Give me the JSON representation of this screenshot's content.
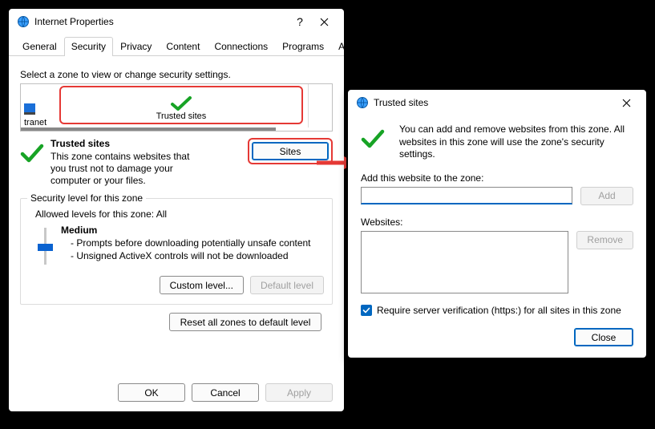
{
  "ip": {
    "title": "Internet Properties",
    "tabs": [
      "General",
      "Security",
      "Privacy",
      "Content",
      "Connections",
      "Programs",
      "Advanced"
    ],
    "active_tab": 1,
    "zone_instruction": "Select a zone to view or change security settings.",
    "zone_left_label": "tranet",
    "zone_center_label": "Trusted sites",
    "zone_title": "Trusted sites",
    "zone_desc": "This zone contains websites that you trust not to damage your computer or your files.",
    "sites_btn": "Sites",
    "group_title": "Security level for this zone",
    "allowed_levels": "Allowed levels for this zone: All",
    "level_name": "Medium",
    "level_line1": "- Prompts before downloading potentially unsafe content",
    "level_line2": "- Unsigned ActiveX controls will not be downloaded",
    "custom_btn": "Custom level...",
    "default_btn": "Default level",
    "reset_btn": "Reset all zones to default level",
    "ok_btn": "OK",
    "cancel_btn": "Cancel",
    "apply_btn": "Apply",
    "help_glyph": "?"
  },
  "ts": {
    "title": "Trusted sites",
    "intro": "You can add and remove websites from this zone. All websites in this zone will use the zone's security settings.",
    "add_label": "Add this website to the zone:",
    "add_btn": "Add",
    "websites_label": "Websites:",
    "remove_btn": "Remove",
    "https_label": "Require server verification (https:) for all sites in this zone",
    "https_checked": true,
    "close_btn": "Close",
    "input_value": ""
  }
}
